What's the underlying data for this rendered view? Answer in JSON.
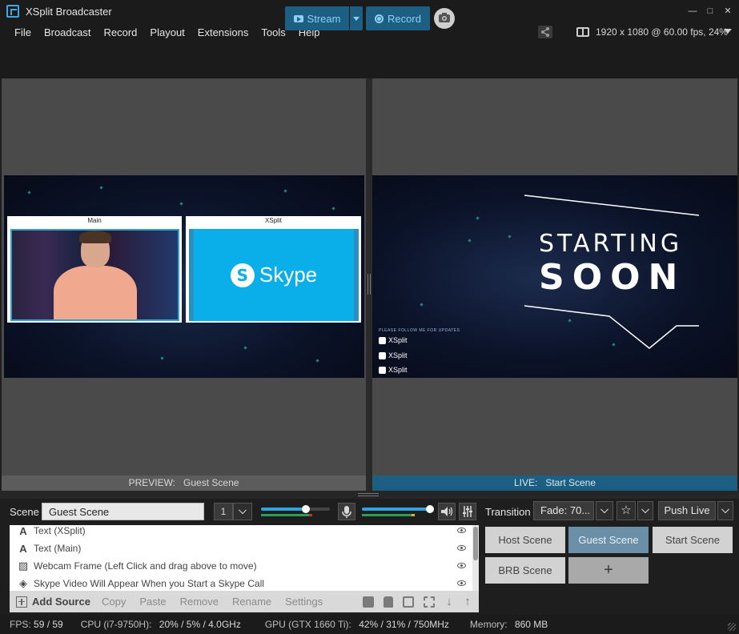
{
  "window": {
    "title": "XSplit Broadcaster",
    "controls": {
      "minimize": "—",
      "maximize": "□",
      "close": "✕"
    }
  },
  "menu": [
    "File",
    "Broadcast",
    "Record",
    "Playout",
    "Extensions",
    "Tools",
    "Help"
  ],
  "resolution": "1920 x 1080 @ 60.00 fps, 24%",
  "toolbar": {
    "stream_label": "Stream",
    "record_label": "Record"
  },
  "preview": {
    "status_prefix": "PREVIEW:",
    "scene_name": "Guest Scene",
    "slot_main_label": "Main",
    "slot_xsplit_label": "XSplit",
    "skype_text": "Skype"
  },
  "live": {
    "status_prefix": "LIVE:",
    "scene_name": "Start Scene",
    "title_line1": "STARTING",
    "title_line2": "SOON",
    "follow_text": "PLEASE FOLLOW ME FOR UPDATES",
    "socials": [
      "XSplit",
      "XSplit",
      "XSplit"
    ]
  },
  "scene_bar": {
    "label": "Scene",
    "current_scene": "Guest Scene",
    "scene_number": "1"
  },
  "sources": [
    {
      "icon": "text-icon",
      "label": "Text (XSplit)"
    },
    {
      "icon": "text-icon",
      "label": "Text (Main)"
    },
    {
      "icon": "image-icon",
      "label": "Webcam Frame (Left Click and drag above to move)"
    },
    {
      "icon": "gamepad-icon",
      "label": "Skype Video Will Appear When you Start a Skype Call"
    }
  ],
  "source_toolbar": {
    "add_source": "Add Source",
    "copy": "Copy",
    "paste": "Paste",
    "remove": "Remove",
    "rename": "Rename",
    "settings": "Settings"
  },
  "transition": {
    "label": "Transition",
    "value": "Fade: 70...",
    "star": "☆",
    "push_live": "Push Live"
  },
  "scenes": [
    {
      "name": "Host Scene",
      "active": false
    },
    {
      "name": "Guest Scene",
      "active": true
    },
    {
      "name": "Start Scene",
      "active": false
    },
    {
      "name": "BRB Scene",
      "active": false
    }
  ],
  "add_scene_symbol": "+",
  "statusbar": {
    "fps_label": "FPS:",
    "fps_value": "59 / 59",
    "cpu_label": "CPU (i7-9750H):",
    "cpu_value": "20% / 5% / 4.0GHz",
    "gpu_label": "GPU (GTX 1660 Ti):",
    "gpu_value": "42% / 31% / 750MHz",
    "mem_label": "Memory:",
    "mem_value": "860 MB"
  },
  "colors": {
    "accent_blue": "#1c5f83",
    "accent_text": "#8fd0f2",
    "skype_blue": "#0aaee8",
    "active_scene": "#6b8fa6"
  }
}
